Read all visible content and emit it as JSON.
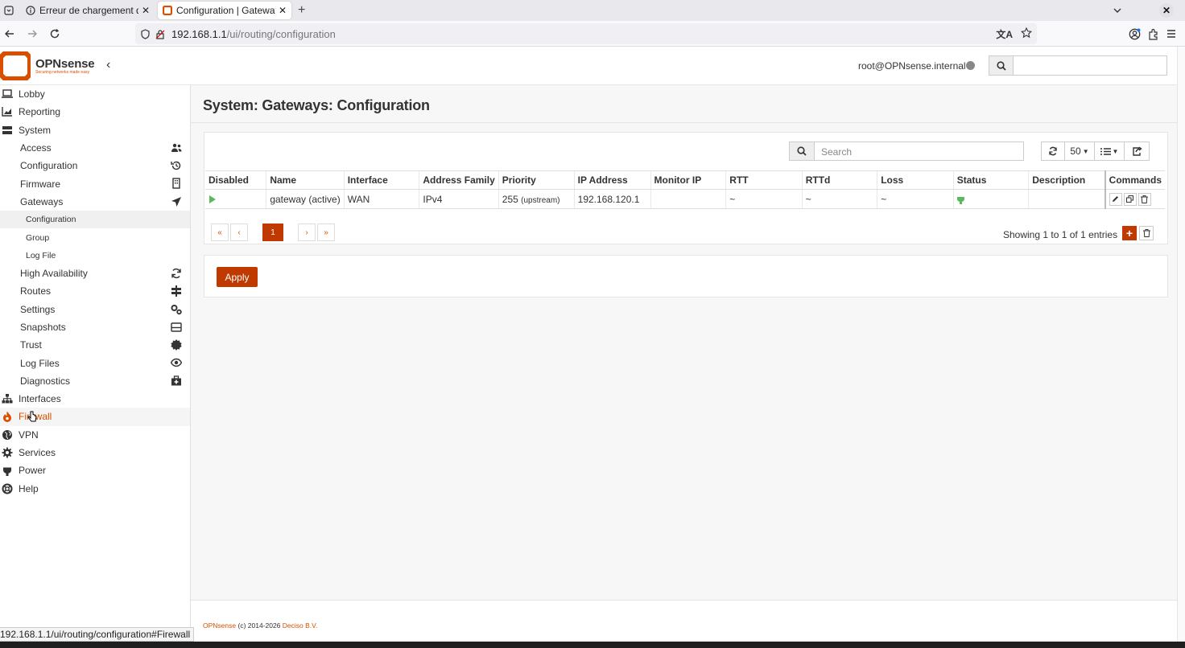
{
  "browser": {
    "tabs": [
      {
        "title": "Erreur de chargement de la page",
        "active": false
      },
      {
        "title": "Configuration | Gateways | System | OPNsense",
        "active": true
      }
    ],
    "url_host": "192.168.1.1",
    "url_path": "/ui/routing/configuration",
    "status_url": "192.168.1.1/ui/routing/configuration#Firewall"
  },
  "header": {
    "brand": "OPNsense",
    "tagline": "Securing networks made easy",
    "user": "root@OPNsense.internal"
  },
  "sidebar": {
    "items": [
      {
        "label": "Lobby",
        "level": "top",
        "icon": "laptop-icon"
      },
      {
        "label": "Reporting",
        "level": "top",
        "icon": "chart-icon"
      },
      {
        "label": "System",
        "level": "top",
        "icon": "server-icon"
      },
      {
        "label": "Access",
        "level": "sub",
        "icon": "users-icon"
      },
      {
        "label": "Configuration",
        "level": "sub",
        "icon": "history-icon"
      },
      {
        "label": "Firmware",
        "level": "sub",
        "icon": "building-icon"
      },
      {
        "label": "Gateways",
        "level": "sub",
        "icon": "location-arrow-icon"
      },
      {
        "label": "Configuration",
        "level": "sub2",
        "selected": true
      },
      {
        "label": "Group",
        "level": "sub2"
      },
      {
        "label": "Log File",
        "level": "sub2"
      },
      {
        "label": "High Availability",
        "level": "sub",
        "icon": "refresh-icon"
      },
      {
        "label": "Routes",
        "level": "sub",
        "icon": "signpost-icon"
      },
      {
        "label": "Settings",
        "level": "sub",
        "icon": "cogs-icon"
      },
      {
        "label": "Snapshots",
        "level": "sub",
        "icon": "hdd-icon"
      },
      {
        "label": "Trust",
        "level": "sub",
        "icon": "certificate-icon"
      },
      {
        "label": "Log Files",
        "level": "sub",
        "icon": "eye-icon"
      },
      {
        "label": "Diagnostics",
        "level": "sub",
        "icon": "medkit-icon"
      },
      {
        "label": "Interfaces",
        "level": "top",
        "icon": "sitemap-icon"
      },
      {
        "label": "Firewall",
        "level": "top",
        "icon": "fire-icon",
        "hover": true
      },
      {
        "label": "VPN",
        "level": "top",
        "icon": "globe-icon"
      },
      {
        "label": "Services",
        "level": "top",
        "icon": "cog-icon"
      },
      {
        "label": "Power",
        "level": "top",
        "icon": "plug-icon"
      },
      {
        "label": "Help",
        "level": "top",
        "icon": "lifebuoy-icon"
      }
    ]
  },
  "main": {
    "title": "System: Gateways: Configuration",
    "search_placeholder": "Search",
    "page_size": "50",
    "columns": [
      "Disabled",
      "Name",
      "Interface",
      "Address Family",
      "Priority",
      "IP Address",
      "Monitor IP",
      "RTT",
      "RTTd",
      "Loss",
      "Status",
      "Description",
      "Commands"
    ],
    "rows": [
      {
        "name": "gateway",
        "name_suffix": "(active)",
        "interface": "WAN",
        "family": "IPv4",
        "priority": "255",
        "priority_note": "(upstream)",
        "ip": "192.168.120.1",
        "monitor_ip": "",
        "rtt": "~",
        "rttd": "~",
        "loss": "~",
        "description": ""
      }
    ],
    "pager": [
      "«",
      "‹",
      "1",
      "›",
      "»"
    ],
    "showing": "Showing 1 to 1 of 1 entries",
    "apply_label": "Apply"
  },
  "footer": {
    "brand": "OPNsense",
    "copyright": "(c) 2014-2026",
    "company": "Deciso B.V."
  },
  "colors": {
    "accent": "#c03900",
    "brand_orange": "#d94f00",
    "status_green": "#5cb85c"
  }
}
